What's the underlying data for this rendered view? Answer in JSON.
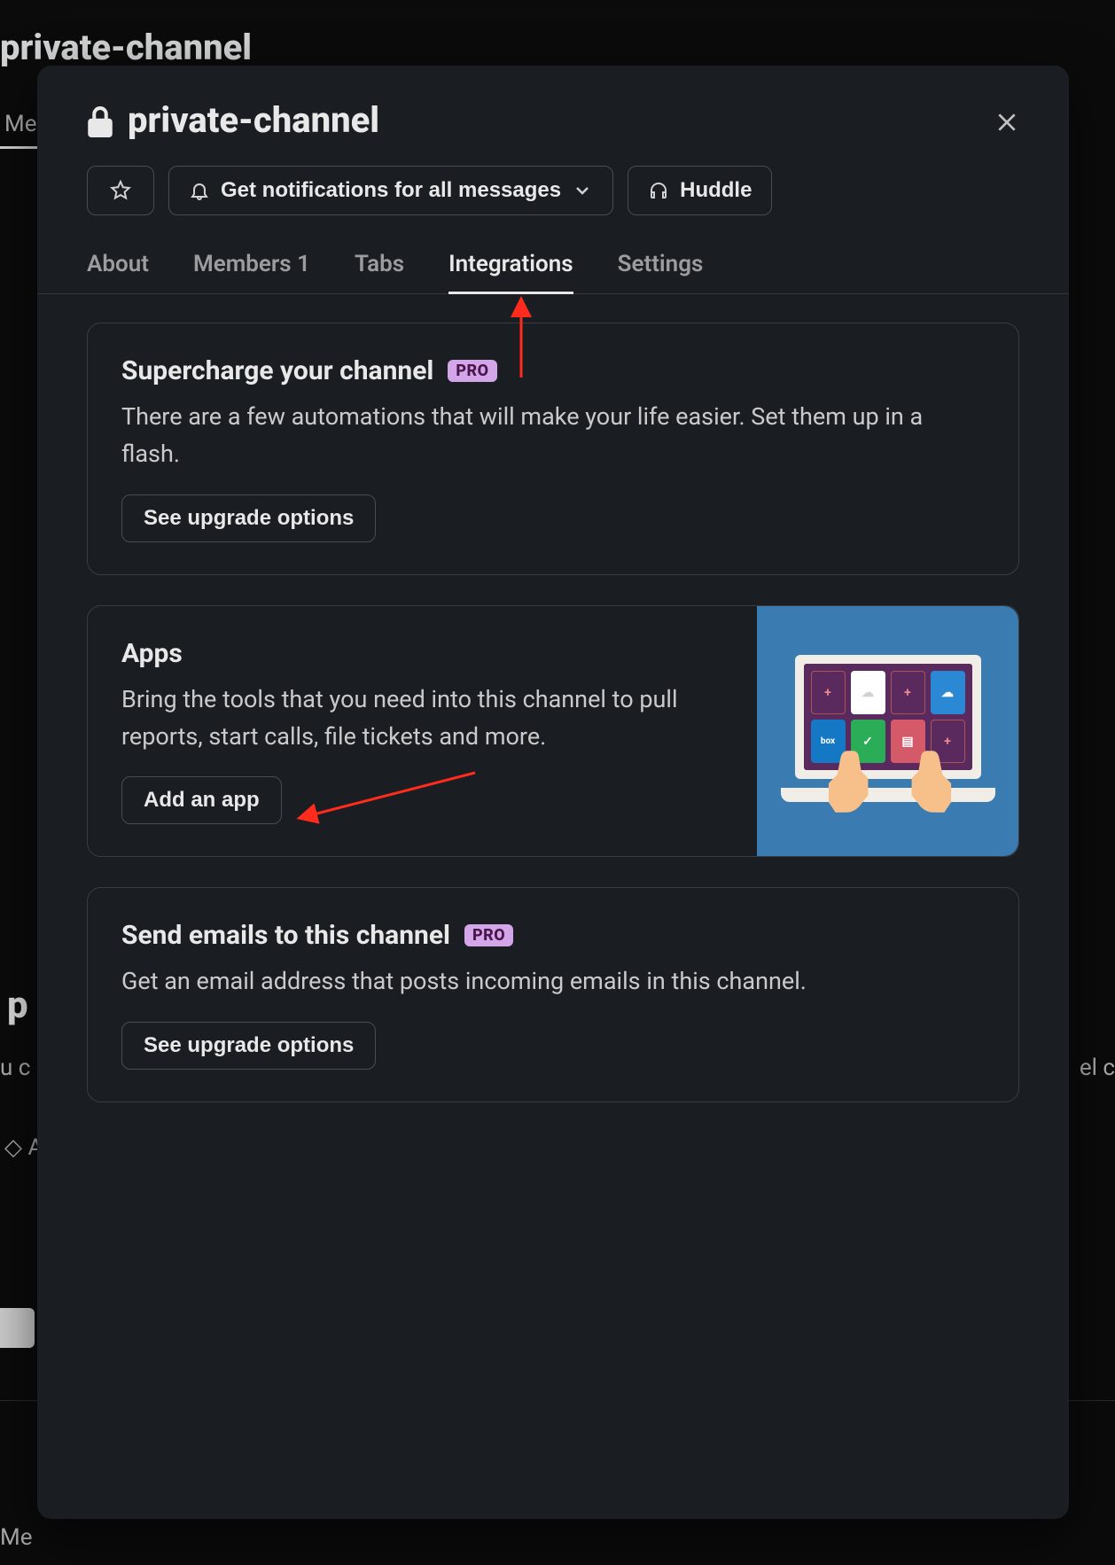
{
  "background": {
    "header": "private-channel",
    "tab_me": "Me"
  },
  "modal": {
    "title": "private-channel",
    "notifications_label": "Get notifications for all messages",
    "huddle_label": "Huddle",
    "tabs": {
      "about": "About",
      "members": "Members 1",
      "tabs": "Tabs",
      "integrations": "Integrations",
      "settings": "Settings"
    },
    "cards": {
      "supercharge": {
        "title": "Supercharge your channel",
        "badge": "PRO",
        "body": "There are a few automations that will make your life easier. Set them up in a flash.",
        "button": "See upgrade options"
      },
      "apps": {
        "title": "Apps",
        "body": "Bring the tools that you need into this channel to pull reports, start calls, file tickets and more.",
        "button": "Add an app"
      },
      "emails": {
        "title": "Send emails to this channel",
        "badge": "PRO",
        "body": "Get an email address that posts incoming emails in this channel.",
        "button": "See upgrade options"
      }
    }
  }
}
